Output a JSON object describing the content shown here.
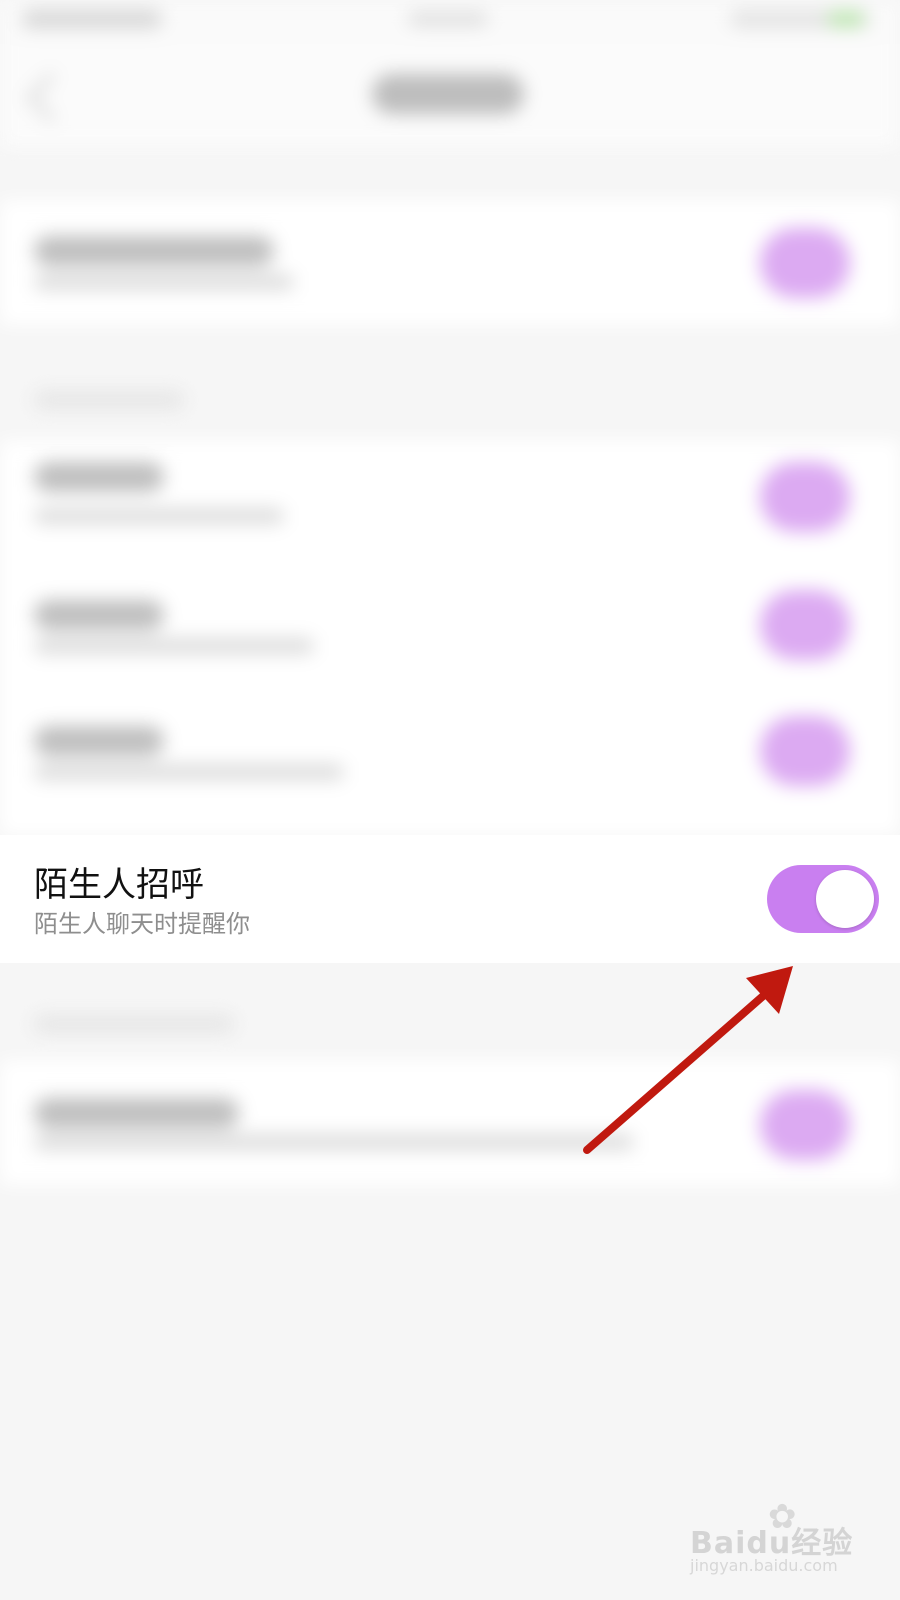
{
  "focused_setting": {
    "title": "陌生人招呼",
    "subtitle": "陌生人聊天时提醒你",
    "enabled": true
  },
  "colors": {
    "toggle_on": "#c97ff0",
    "annotation_arrow": "#c0190f",
    "background": "#f6f6f6"
  },
  "watermark": {
    "brand": "Baidu经验",
    "url": "jingyan.baidu.com"
  },
  "icons": {
    "back": "chevron-left-icon",
    "watermark": "paw-icon"
  }
}
